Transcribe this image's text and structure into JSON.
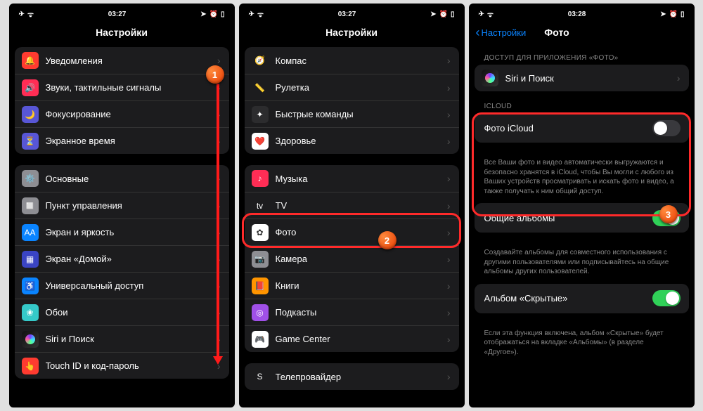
{
  "screen1": {
    "status_time": "03:27",
    "title": "Настройки",
    "group1": [
      {
        "label": "Уведомления",
        "icon_bg": "#ff3b30",
        "glyph": "🔔"
      },
      {
        "label": "Звуки, тактильные сигналы",
        "icon_bg": "#ff2d55",
        "glyph": "🔊"
      },
      {
        "label": "Фокусирование",
        "icon_bg": "#5856d6",
        "glyph": "🌙"
      },
      {
        "label": "Экранное время",
        "icon_bg": "#5856d6",
        "glyph": "⏳"
      }
    ],
    "group2": [
      {
        "label": "Основные",
        "icon_bg": "#8e8e93",
        "glyph": "⚙️"
      },
      {
        "label": "Пункт управления",
        "icon_bg": "#8e8e93",
        "glyph": "◻️"
      },
      {
        "label": "Экран и яркость",
        "icon_bg": "#0a84ff",
        "glyph": "AA"
      },
      {
        "label": "Экран «Домой»",
        "icon_bg": "#3a44c4",
        "glyph": "▦"
      },
      {
        "label": "Универсальный доступ",
        "icon_bg": "#0a84ff",
        "glyph": "♿"
      },
      {
        "label": "Обои",
        "icon_bg": "#35c9c9",
        "glyph": "❀"
      },
      {
        "label": "Siri и Поиск",
        "icon_bg": "siri",
        "glyph": ""
      },
      {
        "label": "Touch ID и код-пароль",
        "icon_bg": "#ff3b30",
        "glyph": "👆"
      }
    ]
  },
  "screen2": {
    "status_time": "03:27",
    "title": "Настройки",
    "group1": [
      {
        "label": "Компас",
        "icon_bg": "#1c1c1e",
        "glyph": "🧭"
      },
      {
        "label": "Рулетка",
        "icon_bg": "#1c1c1e",
        "glyph": "📏"
      },
      {
        "label": "Быстрые команды",
        "icon_bg": "#2c2c2e",
        "glyph": "✦"
      },
      {
        "label": "Здоровье",
        "icon_bg": "#ffffff",
        "glyph": "❤️"
      }
    ],
    "group2": [
      {
        "label": "Музыка",
        "icon_bg": "#ff2d55",
        "glyph": "♪"
      },
      {
        "label": "TV",
        "icon_bg": "#1c1c1e",
        "glyph": "tv"
      },
      {
        "label": "Фото",
        "icon_bg": "#ffffff",
        "glyph": "✿",
        "highlight": true
      },
      {
        "label": "Камера",
        "icon_bg": "#8e8e93",
        "glyph": "📷"
      },
      {
        "label": "Книги",
        "icon_bg": "#ff9500",
        "glyph": "📕"
      },
      {
        "label": "Подкасты",
        "icon_bg": "#a050e8",
        "glyph": "◎"
      },
      {
        "label": "Game Center",
        "icon_bg": "#ffffff",
        "glyph": "🎮"
      }
    ],
    "group3": [
      {
        "label": "Телепровайдер",
        "icon_bg": "#1c1c1e",
        "glyph": "S"
      }
    ]
  },
  "screen3": {
    "status_time": "03:28",
    "back": "Настройки",
    "title": "Фото",
    "section1_header": "ДОСТУП ДЛЯ ПРИЛОЖЕНИЯ «ФОТО»",
    "row_siri": "Siri и Поиск",
    "section2_header": "ICLOUD",
    "row_icloud_photo": "Фото iCloud",
    "icloud_on": false,
    "icloud_footer": "Все Ваши фото и видео автоматически выгружаются и безопасно хранятся в iCloud, чтобы Вы могли с любого из Ваших устройств просматривать и искать фото и видео, а также получать к ним общий доступ.",
    "row_shared": "Общие альбомы",
    "shared_on": true,
    "shared_footer": "Создавайте альбомы для совместного использования с другими пользователями или подписывайтесь на общие альбомы других пользователей.",
    "row_hidden": "Альбом «Скрытые»",
    "hidden_on": true,
    "hidden_footer": "Если эта функция включена, альбом «Скрытые» будет отображаться на вкладке «Альбомы» (в разделе «Другое»)."
  },
  "markers": [
    "1",
    "2",
    "3"
  ]
}
